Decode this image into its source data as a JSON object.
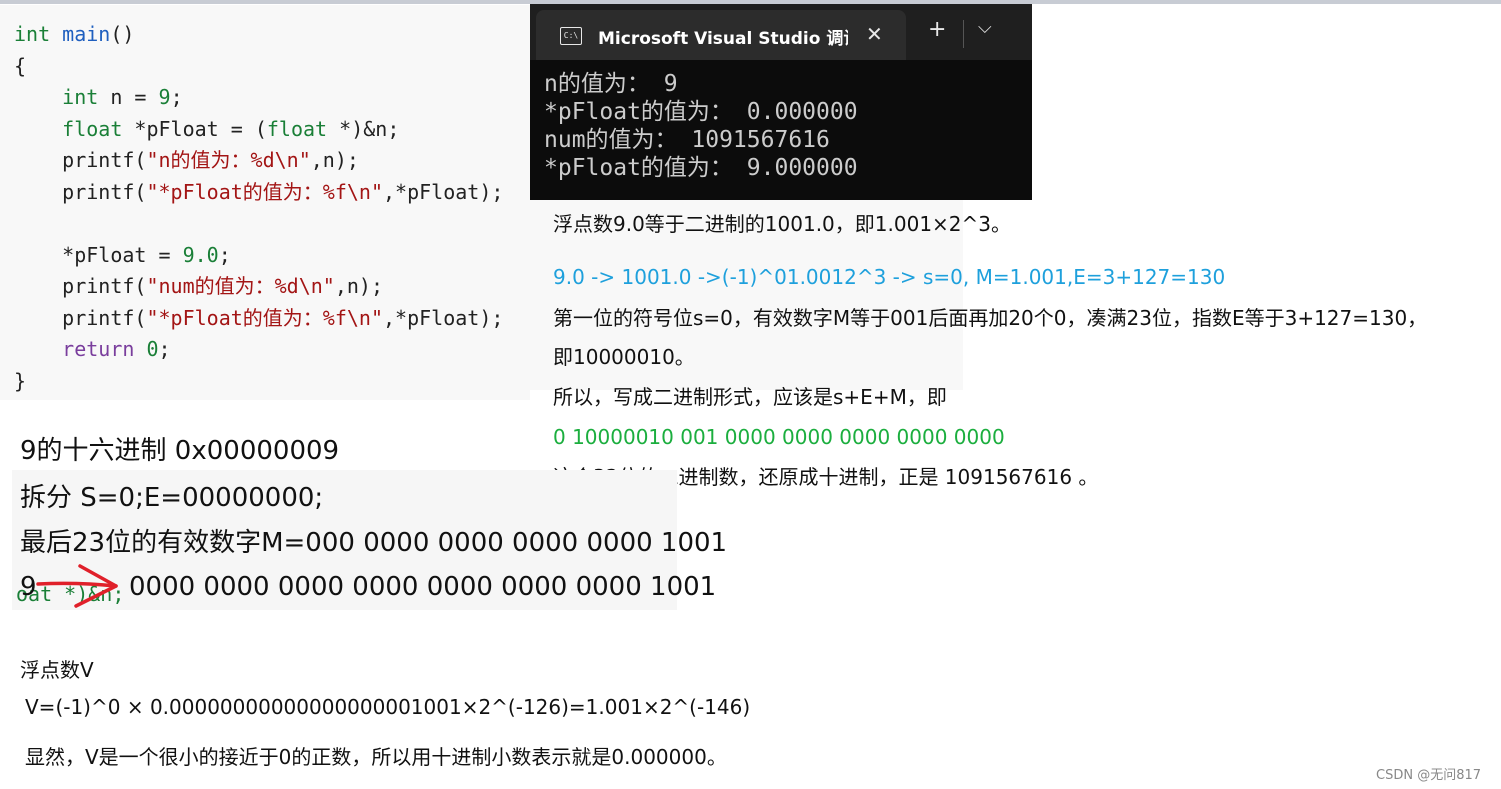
{
  "code_lines": [
    "int main()",
    "{",
    "    int n = 9;",
    "    float *pFloat = (float *)&n;",
    "    printf(\"n的值为：%d\\n\",n);",
    "    printf(\"*pFloat的值为：%f\\n\",*pFloat);",
    "",
    "    *pFloat = 9.0;",
    "    printf(\"num的值为：%d\\n\",n);",
    "    printf(\"*pFloat的值为：%f\\n\",*pFloat);",
    "    return 0;",
    "}"
  ],
  "terminal": {
    "title": "Microsoft Visual Studio 调试控制台",
    "icon": "console-icon",
    "lines": [
      "n的值为： 9",
      "*pFloat的值为： 0.000000",
      "num的值为： 1091567616",
      "*pFloat的值为： 9.000000"
    ]
  },
  "explanation": {
    "line1": "浮点数9.0等于二进制的1001.0，即1.001×2^3。",
    "line2": "9.0 -> 1001.0 ->(-1)^01.0012^3 -> s=0, M=1.001,E=3+127=130",
    "line3": "第一位的符号位s=0，有效数字M等于001后面再加20个0，凑满23位，指数E等于3+127=130，",
    "line4": "即10000010。",
    "line5": "所以，写成二进制形式，应该是s+E+M，即",
    "line6": "0 10000010 001 0000 0000 0000 0000 0000",
    "line7": "这个32位的二进制数，还原成十进制，正是 1091567616 。"
  },
  "hex": {
    "line1": "9的十六进制 0x00000009",
    "line2": "拆分 S=0;E=00000000;",
    "line3": "最后23位的有效数字M=000 0000 0000 0000 0000 1001",
    "arrow_left": "9",
    "arrow_right": "0000 0000 0000 0000 0000 0000 0000 1001",
    "overlay_code": "oat *)&n;"
  },
  "float_v": {
    "title": "浮点数V",
    "formula": "V=(-1)^0 × 0.00000000000000000001001×2^(-126)=1.001×2^(-146)",
    "conclusion": "显然，V是一个很小的接近于0的正数，所以用十进制小数表示就是0.000000。"
  },
  "watermark": "CSDN @无问817",
  "colors": {
    "accent_blue": "#1ea0dc",
    "accent_green": "#1bae3e",
    "arrow_red": "#e0202a",
    "terminal_bg": "#0c0c0c"
  }
}
